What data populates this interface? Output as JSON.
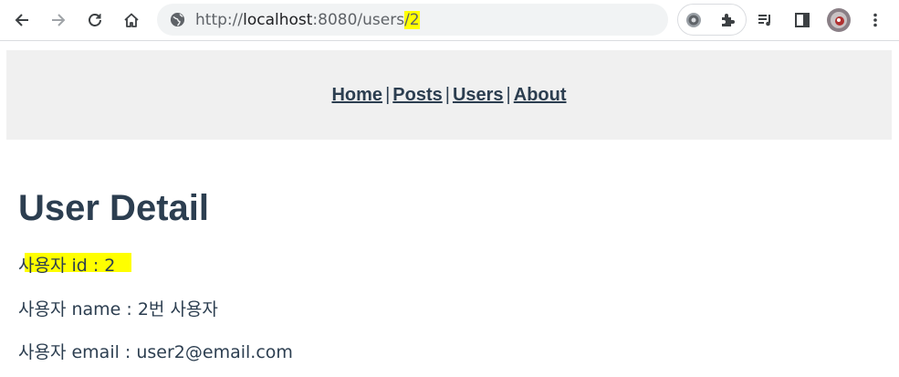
{
  "browser": {
    "url_prefix": "http://",
    "url_host": "localhost",
    "url_path": ":8080/users",
    "url_highlight": "/2",
    "icons": [
      "back-icon",
      "forward-icon",
      "reload-icon",
      "home-icon",
      "globe-icon",
      "settings-extension-icon",
      "puzzle-extensions-icon",
      "media-playlist-icon",
      "side-panel-icon",
      "profile-avatar",
      "more-vert-icon"
    ]
  },
  "nav": {
    "items": [
      "Home",
      "Posts",
      "Users",
      "About"
    ],
    "separator": "|"
  },
  "page": {
    "title": "User Detail",
    "id_line": "사용자 id : 2",
    "name_line": "사용자 name : 2번 사용자",
    "email_line": "사용자 email : user2@email.com",
    "highlight_color": "#ffff00",
    "text_color": "#2c3e50"
  }
}
